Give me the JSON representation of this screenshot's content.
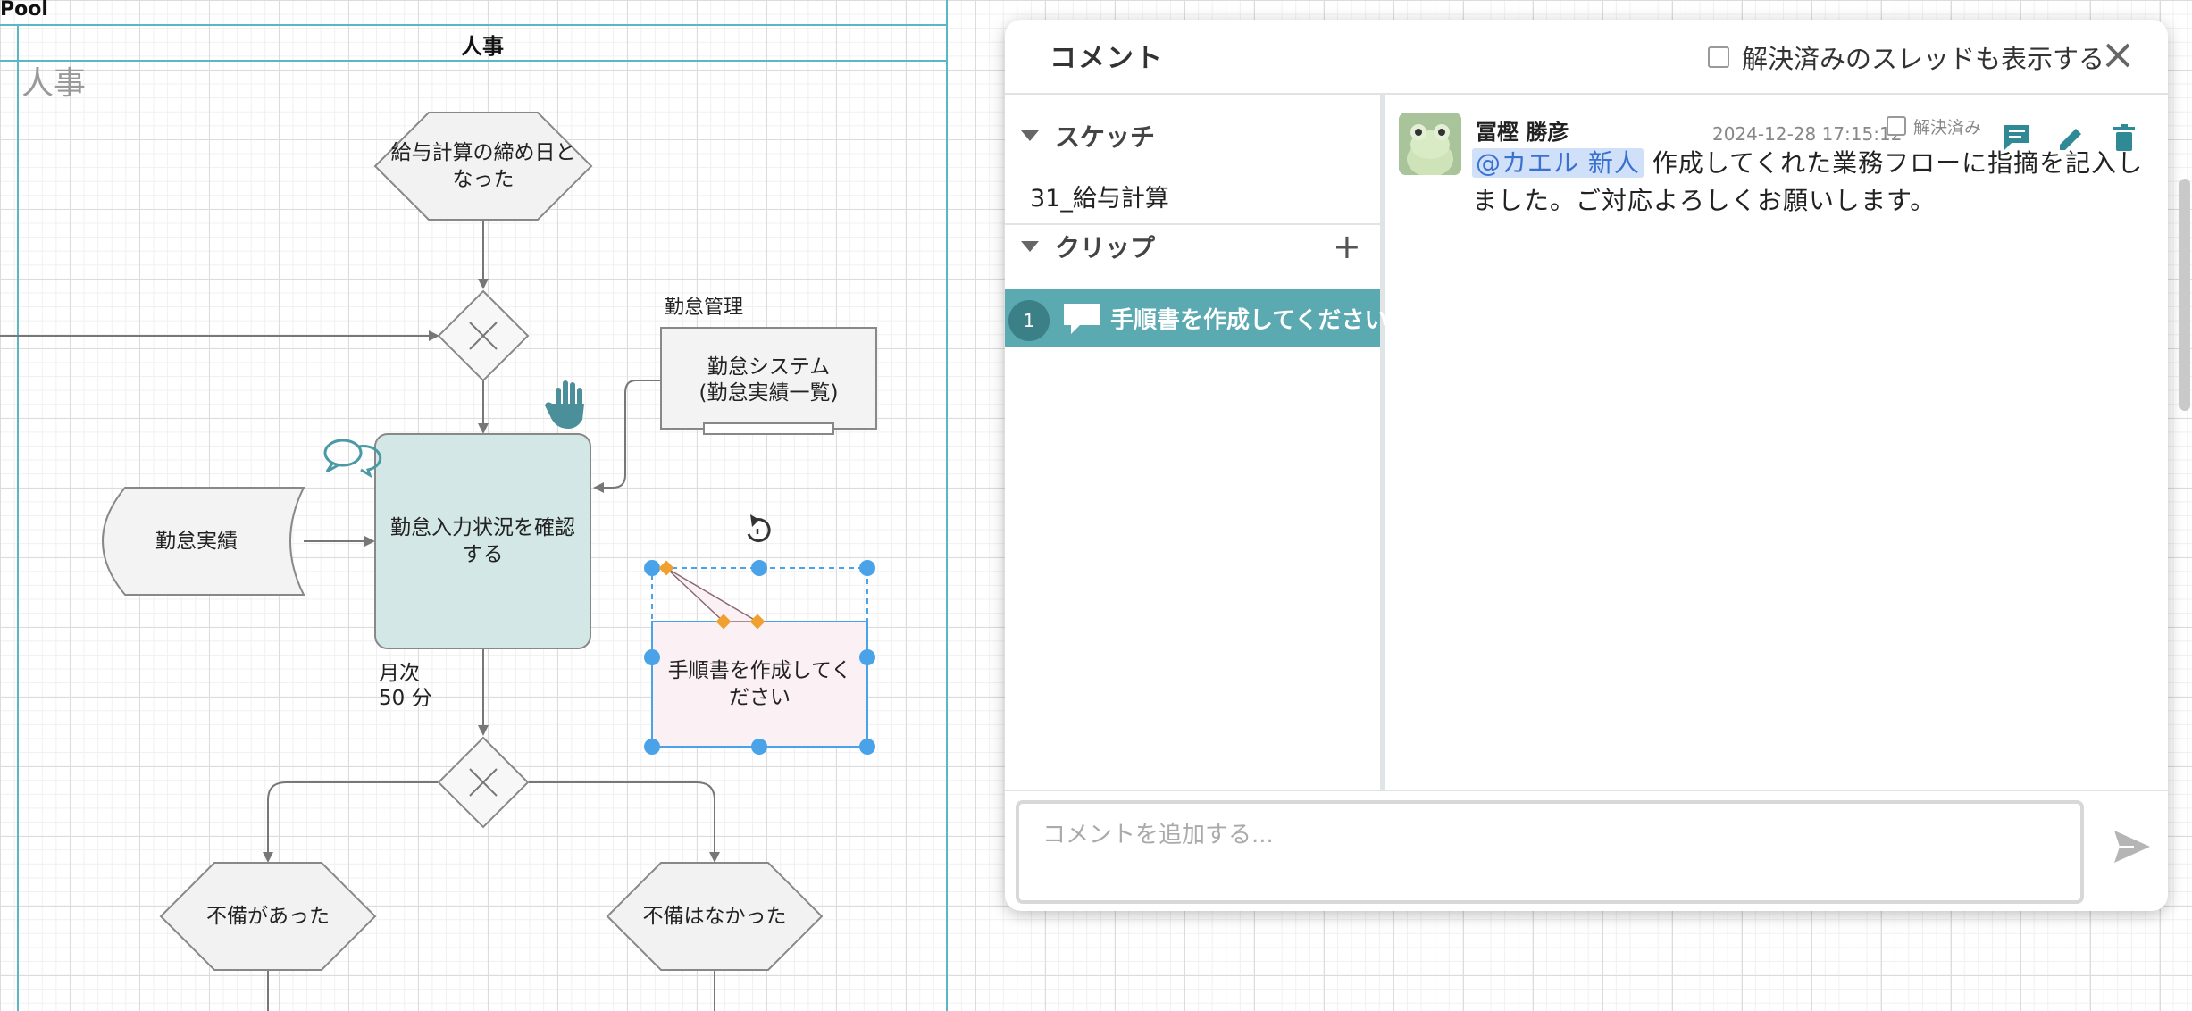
{
  "diagram": {
    "pool_label": "Pool",
    "lane_header": "人事",
    "lane_watermark": "人事",
    "event_payroll_close": "給与計算の締め日となった",
    "gateway_top": "",
    "annotation_attendance_mgmt": "勤怠管理",
    "system_box": [
      "勤怠システム",
      "(勤怠実績一覧)"
    ],
    "task_check_attendance": "勤怠入力状況を確認する",
    "data_attendance_record": "勤怠実績",
    "task_meta": [
      "月次",
      "50 分"
    ],
    "note_text": "手順書を作成してください",
    "event_deficient": "不備があった",
    "event_not_deficient": "不備はなかった"
  },
  "comments_panel": {
    "title": "コメント",
    "show_resolved_label": "解決済みのスレッドも表示する",
    "sections": {
      "sketch_label": "スケッチ",
      "sketch_name": "31_給与計算",
      "clip_label": "クリップ",
      "clip_add": "+"
    },
    "clips": [
      {
        "number": "1",
        "label": "手順書を作成してください"
      }
    ],
    "thread": {
      "author": "冨樫 勝彦",
      "timestamp": "2024-12-28 17:15:12",
      "resolved_label": "解決済み",
      "mention": "@カエル 新人",
      "body": "作成してくれた業務フローに指摘を記入しました。ご対応よろしくお願いします。"
    },
    "input_placeholder": "コメントを追加する..."
  },
  "colors": {
    "accent_teal": "#5ba9b1",
    "task_fill": "#d3e7e6",
    "note_fill": "#fbf0f3",
    "selection_blue": "#4aa3e8",
    "handle_orange": "#f0a030",
    "mention_bg": "#cfe0f8",
    "icon_teal": "#2f8a96"
  }
}
